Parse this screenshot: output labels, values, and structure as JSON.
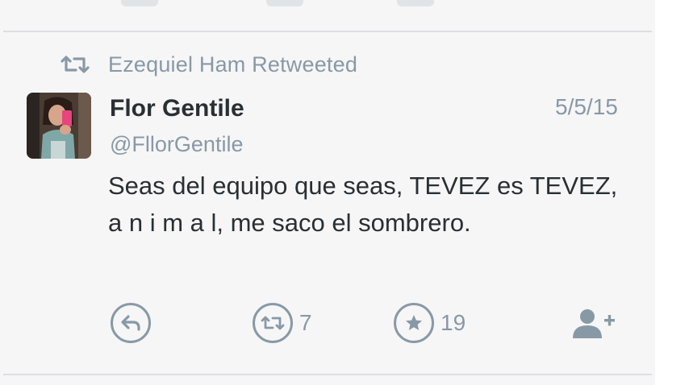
{
  "retweet_banner": {
    "icon": "retweet-icon",
    "text": "Ezequiel Ham Retweeted"
  },
  "tweet": {
    "author_name": "Flor Gentile",
    "author_handle": "@FllorGentile",
    "date": "5/5/15",
    "text": "Seas del equipo que seas, TEVEZ es TEVEZ, a n i m a l, me saco el sombrero.",
    "avatar_icon": "avatar-photo"
  },
  "actions": {
    "reply": {
      "icon": "reply-icon"
    },
    "retweet": {
      "icon": "retweet-icon",
      "count": "7"
    },
    "favorite": {
      "icon": "star-icon",
      "count": "19"
    },
    "follow": {
      "icon": "add-user-icon"
    }
  },
  "colors": {
    "background": "#f6f6f7",
    "primary_text": "#292f33",
    "secondary_text": "#8899a6",
    "divider": "#dcdfe2"
  }
}
